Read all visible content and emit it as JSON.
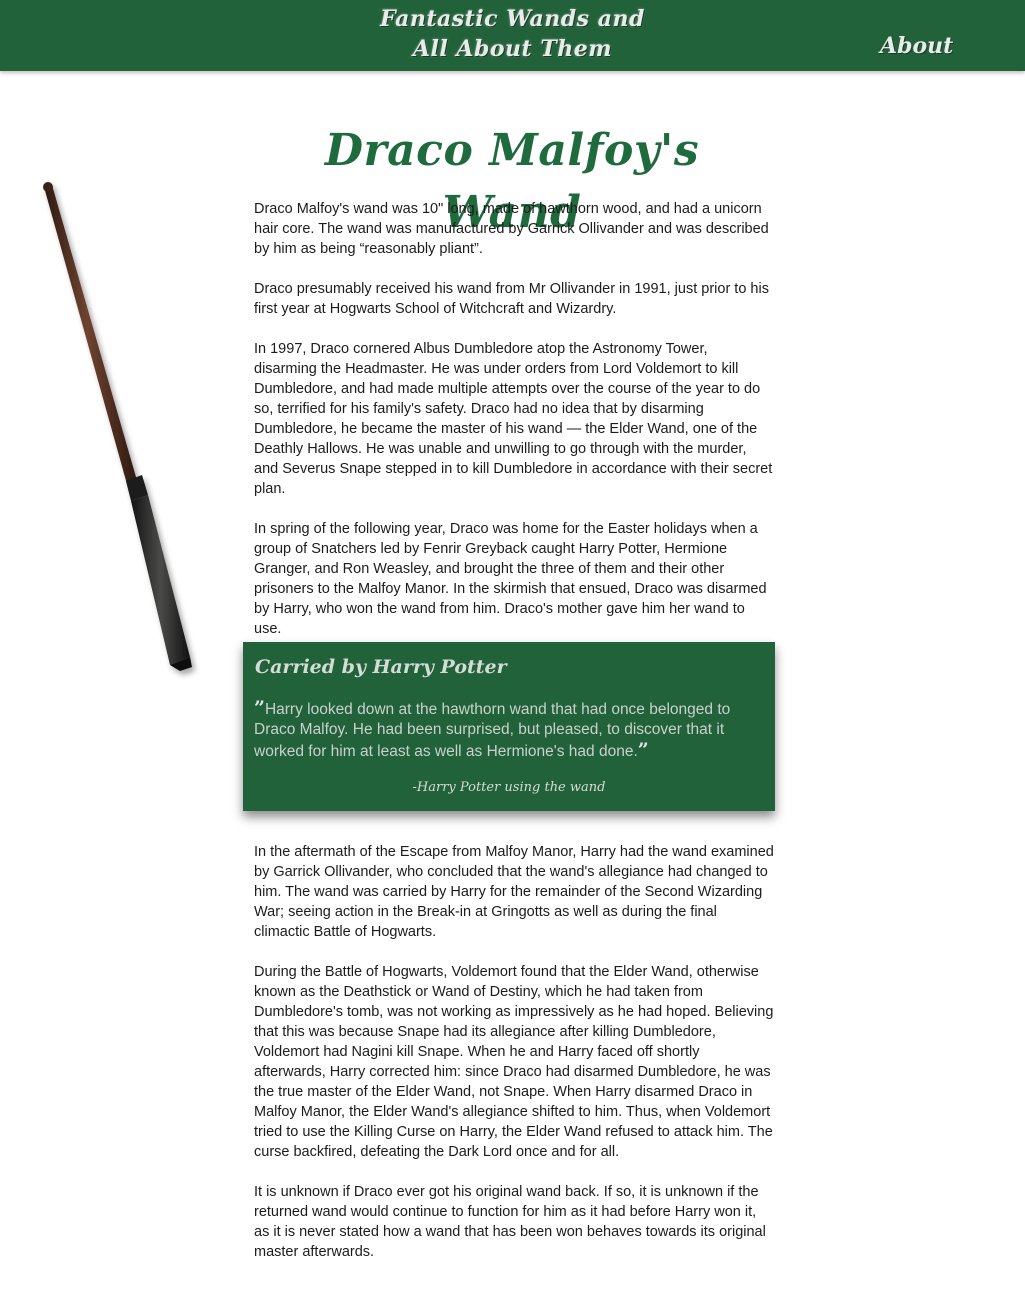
{
  "header": {
    "site_title_line1": "Fantastic Wands and",
    "site_title_line2": "All About Them",
    "about_label": "About"
  },
  "page": {
    "heading": "Draco Malfoy's Wand"
  },
  "paragraphs_top": [
    "Draco Malfoy's wand was 10\" long, made of hawthorn wood, and had a unicorn hair core. The wand was manufactured by Garrick Ollivander and was described by him as being “reasonably pliant”.",
    "Draco presumably received his wand from Mr Ollivander in 1991, just prior to his first year at Hogwarts School of Witchcraft and Wizardry.",
    "In 1997, Draco cornered Albus Dumbledore atop the Astronomy Tower, disarming the Headmaster. He was under orders from Lord Voldemort to kill Dumbledore, and had made multiple attempts over the course of the year to do so, terrified for his family's safety. Draco had no idea that by disarming Dumbledore, he became the master of his wand — the Elder Wand, one of the Deathly Hallows. He was unable and unwilling to go through with the murder, and Severus Snape stepped in to kill Dumbledore in accordance with their secret plan.",
    "In spring of the following year, Draco was home for the Easter holidays when a group of Snatchers led by Fenrir Greyback caught Harry Potter, Hermione Granger, and Ron Weasley, and brought the three of them and their other prisoners to the Malfoy Manor. In the skirmish that ensued, Draco was disarmed by Harry, who won the wand from him. Draco's mother gave him her wand to use."
  ],
  "quote": {
    "title": "Carried by Harry Potter",
    "open_mark": "”",
    "text": "Harry looked down at the hawthorn wand that had once belonged to Draco Malfoy. He had been surprised, but pleased, to discover that it worked for him at least as well as Hermione's had done.",
    "close_mark": "”",
    "attribution": "-Harry Potter using the wand"
  },
  "paragraphs_bottom": [
    "In the aftermath of the Escape from Malfoy Manor, Harry had the wand examined by Garrick Ollivander, who concluded that the wand's allegiance had changed to him. The wand was carried by Harry for the remainder of the Second Wizarding War; seeing action in the Break-in at Gringotts as well as during the final climactic Battle of Hogwarts.",
    "During the Battle of Hogwarts, Voldemort found that the Elder Wand, otherwise known as the Deathstick or Wand of Destiny, which he had taken from Dumbledore's tomb, was not working as impressively as he had hoped. Believing that this was because Snape had its allegiance after killing Dumbledore, Voldemort had Nagini kill Snape. When he and Harry faced off shortly afterwards, Harry corrected him: since Draco had disarmed Dumbledore, he was the true master of the Elder Wand, not Snape. When Harry disarmed Draco in Malfoy Manor, the Elder Wand's allegiance shifted to him. Thus, when Voldemort tried to use the Killing Curse on Harry, the Elder Wand refused to attack him. The curse backfired, defeating the Dark Lord once and for all.",
    "It is unknown if Draco ever got his original wand back. If so, it is unknown if the returned wand would continue to function for him as it had before Harry won it, as it is never stated how a wand that has been won behaves towards its original master afterwards."
  ],
  "colors": {
    "header_green": "#22623a",
    "heading_green": "#1f6b3e"
  },
  "images": {
    "wand": "wand-image"
  }
}
